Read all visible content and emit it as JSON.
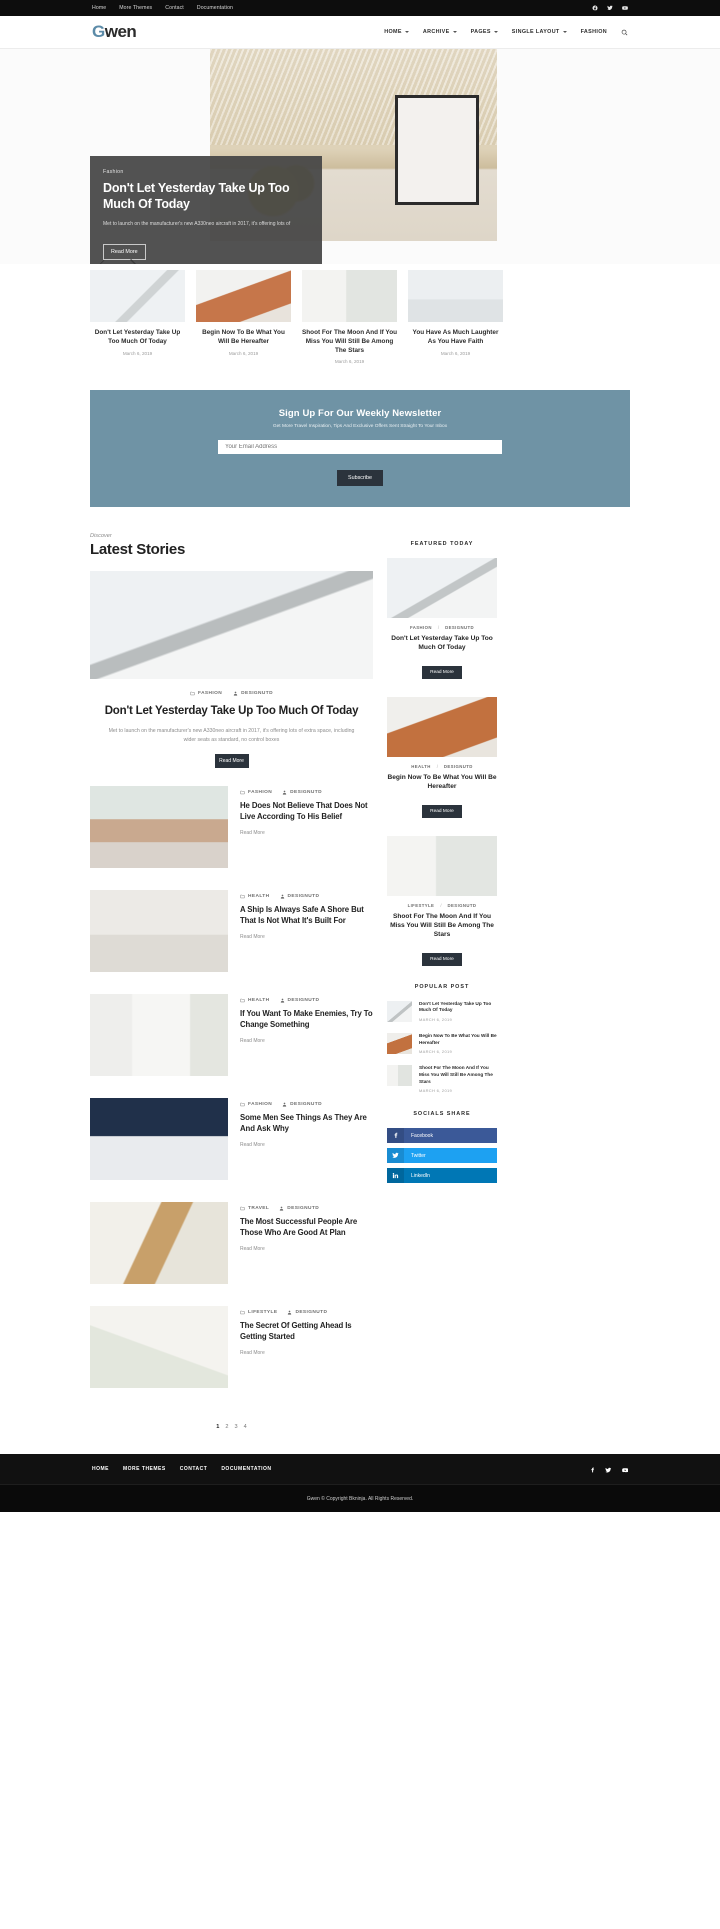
{
  "topbar": {
    "links": [
      "Home",
      "More Themes",
      "Contact",
      "Documentation"
    ],
    "social": [
      "facebook-icon",
      "twitter-icon",
      "youtube-icon"
    ]
  },
  "header": {
    "logo": "Gwen",
    "logo_first": "G",
    "logo_rest": "wen",
    "nav": [
      {
        "label": "HOME",
        "has_dropdown": true
      },
      {
        "label": "ARCHIVE",
        "has_dropdown": true
      },
      {
        "label": "PAGES",
        "has_dropdown": true
      },
      {
        "label": "SINGLE LAYOUT",
        "has_dropdown": true
      },
      {
        "label": "FASHION",
        "has_dropdown": false
      }
    ],
    "search": "search-icon"
  },
  "hero": {
    "category": "Fashion",
    "title": "Don't Let Yesterday Take Up Too Much Of Today",
    "excerpt": "Met to launch on the manufacturer's new A330neo aircraft in 2017, it's offering lots of",
    "button": "Read More",
    "prev": "prev-arrow",
    "next": "next-arrow"
  },
  "thumbnails": [
    {
      "title": "Don't Let Yesterday Take Up Too Much Of Today",
      "date": "March 6, 2019"
    },
    {
      "title": "Begin Now To Be What You Will Be Hereafter",
      "date": "March 6, 2019"
    },
    {
      "title": "Shoot For The Moon And If You Miss You Will Still Be Among The Stars",
      "date": "March 6, 2019"
    },
    {
      "title": "You Have As Much Laughter As You Have Faith",
      "date": "March 6, 2019"
    }
  ],
  "newsletter": {
    "title": "Sign Up For Our Weekly Newsletter",
    "subtitle": "Get More Travel Inspiration, Tips And Exclusive Offers Sent Straight To Your Inbox",
    "placeholder": "Your Email Address",
    "value": "",
    "button": "Subscribe",
    "bg_color": "#6f93a5"
  },
  "latest": {
    "kicker": "Discover",
    "title": "Latest Stories",
    "featured": {
      "category": "FASHION",
      "author": "DESIGNUTD",
      "title": "Don't Let Yesterday Take Up Too Much Of Today",
      "excerpt": "Met to launch on the manufacturer's new A330neo aircraft in 2017, it's offering lots of extra space, including wider seats as standard, no control boxes",
      "button": "Read More"
    },
    "posts": [
      {
        "category": "FASHION",
        "author": "DESIGNUTD",
        "title": "He Does Not Believe That Does Not Live According To His Belief",
        "readmore": "Read More"
      },
      {
        "category": "HEALTH",
        "author": "DESIGNUTD",
        "title": "A Ship Is Always Safe A Shore But That Is Not What It's Built For",
        "readmore": "Read More"
      },
      {
        "category": "HEALTH",
        "author": "DESIGNUTD",
        "title": "If You Want To Make Enemies, Try To Change Something",
        "readmore": "Read More"
      },
      {
        "category": "FASHION",
        "author": "DESIGNUTD",
        "title": "Some Men See Things As They Are And Ask Why",
        "readmore": "Read More"
      },
      {
        "category": "TRAVEL",
        "author": "DESIGNUTD",
        "title": "The Most Successful People Are Those Who Are Good At Plan",
        "readmore": "Read More"
      },
      {
        "category": "LIFESTYLE",
        "author": "DESIGNUTD",
        "title": "The Secret Of Getting Ahead Is Getting Started",
        "readmore": "Read More"
      }
    ],
    "pagination": [
      "1",
      "2",
      "3",
      "4"
    ],
    "pagination_active": "1"
  },
  "sidebar": {
    "featured_heading": "FEATURED TODAY",
    "featured": [
      {
        "category": "FASHION",
        "author": "DESIGNUTD",
        "title": "Don't Let Yesterday Take Up Too Much Of Today",
        "button": "Read More"
      },
      {
        "category": "HEALTH",
        "author": "DESIGNUTD",
        "title": "Begin Now To Be What You Will Be Hereafter",
        "button": "Read More"
      },
      {
        "category": "LIFESTYLE",
        "author": "DESIGNUTD",
        "title": "Shoot For The Moon And If You Miss You Will Still Be Among The Stars",
        "button": "Read More"
      }
    ],
    "popular_heading": "POPULAR POST",
    "popular": [
      {
        "title": "Don't Let Yesterday Take Up Too Much Of Today",
        "date": "MARCH 6, 2019"
      },
      {
        "title": "Begin Now To Be What You Will Be Hereafter",
        "date": "MARCH 6, 2019"
      },
      {
        "title": "Shoot For The Moon And If You Miss You Will Still Be Among The Stars",
        "date": "MARCH 6, 2019"
      }
    ],
    "socials_heading": "SOCIALS SHARE",
    "socials": [
      {
        "label": "Facebook",
        "color": "#3b5998",
        "icon": "facebook-icon"
      },
      {
        "label": "Twitter",
        "color": "#1da1f2",
        "icon": "twitter-icon"
      },
      {
        "label": "LinkedIn",
        "color": "#0077b5",
        "icon": "linkedin-icon"
      }
    ]
  },
  "footer": {
    "links": [
      "HOME",
      "MORE THEMES",
      "CONTACT",
      "DOCUMENTATION"
    ],
    "social": [
      "facebook-icon",
      "twitter-icon",
      "youtube-icon"
    ],
    "copyright": "Gwen © Copyright Bkninja. All Rights Reserved."
  }
}
